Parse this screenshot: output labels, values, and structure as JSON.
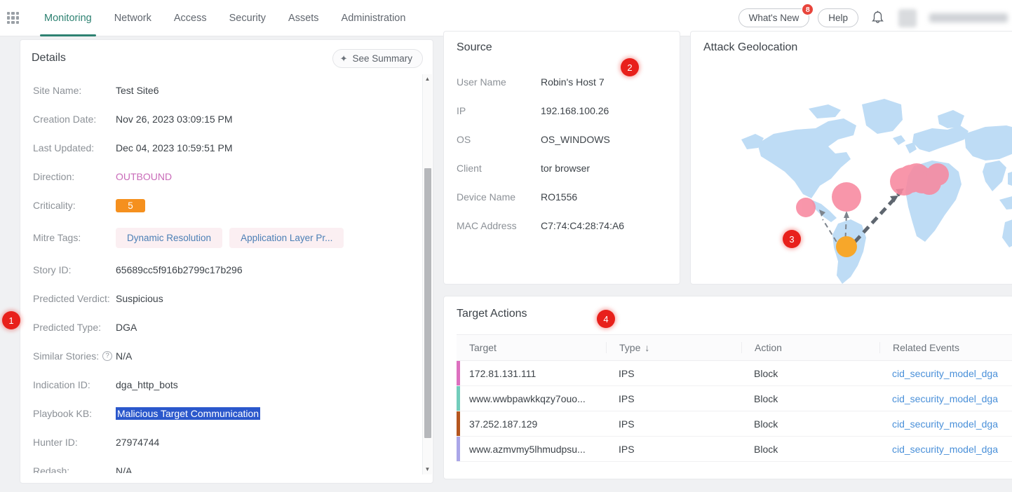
{
  "topnav": {
    "apps_icon": "apps-grid-icon",
    "tabs": [
      {
        "label": "Monitoring",
        "active": true
      },
      {
        "label": "Network",
        "active": false
      },
      {
        "label": "Access",
        "active": false
      },
      {
        "label": "Security",
        "active": false
      },
      {
        "label": "Assets",
        "active": false
      },
      {
        "label": "Administration",
        "active": false
      }
    ],
    "whats_new_label": "What's New",
    "whats_new_badge": "8",
    "help_label": "Help",
    "bell_icon": "notification-bell-icon",
    "accent_color": "#2e8272"
  },
  "details": {
    "title": "Details",
    "summary_button": "See Summary",
    "summary_icon": "sparkle-icon",
    "rows": [
      {
        "label": "Site Name:",
        "value": "Test Site6"
      },
      {
        "label": "Creation Date:",
        "value": "Nov 26, 2023 03:09:15 PM"
      },
      {
        "label": "Last Updated:",
        "value": "Dec 04, 2023 10:59:51 PM"
      },
      {
        "label": "Direction:",
        "value": "OUTBOUND"
      },
      {
        "label": "Criticality:",
        "value": "5"
      },
      {
        "label": "Mitre Tags:",
        "value": ""
      },
      {
        "label": "Story ID:",
        "value": "65689cc5f916b2799c17b296"
      },
      {
        "label": "Predicted Verdict:",
        "value": "Suspicious"
      },
      {
        "label": "Predicted Type:",
        "value": "DGA"
      },
      {
        "label": "Similar Stories:",
        "value": "N/A"
      },
      {
        "label": "Indication ID:",
        "value": "dga_http_bots"
      },
      {
        "label": "Playbook KB:",
        "value": "Malicious Target Communication"
      },
      {
        "label": "Hunter ID:",
        "value": "27974744"
      },
      {
        "label": "Redash:",
        "value": "N/A"
      }
    ],
    "mitre_tags": [
      "Dynamic Resolution",
      "Application Layer Pr..."
    ],
    "criticality_color": "#f5901e",
    "direction_color": "#c96bb9",
    "selection_color": "#2b58cc"
  },
  "source": {
    "title": "Source",
    "rows": [
      {
        "label": "User Name",
        "value": "Robin's Host 7"
      },
      {
        "label": "IP",
        "value": "192.168.100.26"
      },
      {
        "label": "OS",
        "value": "OS_WINDOWS"
      },
      {
        "label": "Client",
        "value": "tor browser"
      },
      {
        "label": "Device Name",
        "value": "RO1556"
      },
      {
        "label": "MAC Address",
        "value": "C7:74:C4:28:74:A6"
      }
    ]
  },
  "geolocation": {
    "title": "Attack Geolocation",
    "land_color": "#bedcf5",
    "attack_marker_color": "#f8889f",
    "source_marker_color": "#f7a72a"
  },
  "target_actions": {
    "title": "Target Actions",
    "columns": [
      "Target",
      "Type",
      "Action",
      "Related Events"
    ],
    "sorted_column": "Type",
    "sort_icon": "arrow-down-icon",
    "rows": [
      {
        "target": "172.81.131.111",
        "type": "IPS",
        "action": "Block",
        "related_events": "cid_security_model_dga",
        "accent": "#dd70bf"
      },
      {
        "target": "www.wwbpawkkqzy7ouo...",
        "type": "IPS",
        "action": "Block",
        "related_events": "cid_security_model_dga",
        "accent": "#72cdbb"
      },
      {
        "target": "37.252.187.129",
        "type": "IPS",
        "action": "Block",
        "related_events": "cid_security_model_dga",
        "accent": "#b4561f"
      },
      {
        "target": "www.azmvmy5lhmudpsu...",
        "type": "IPS",
        "action": "Block",
        "related_events": "cid_security_model_dga",
        "accent": "#aaa6e8"
      }
    ]
  },
  "steps": [
    {
      "number": "1"
    },
    {
      "number": "2"
    },
    {
      "number": "3"
    },
    {
      "number": "4"
    }
  ]
}
